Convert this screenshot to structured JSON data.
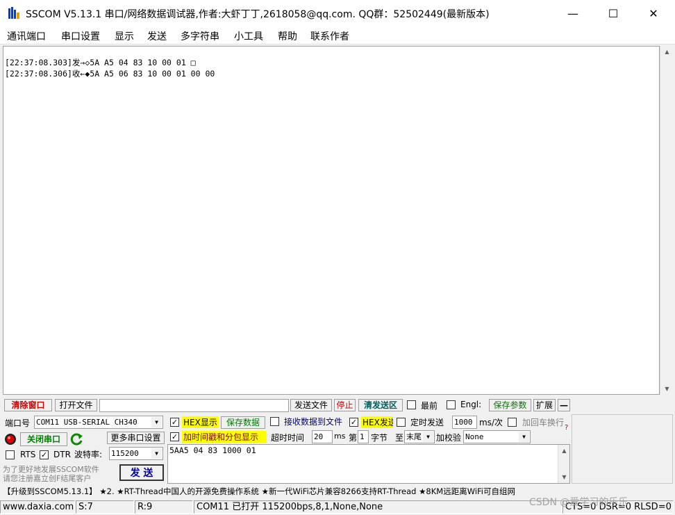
{
  "window": {
    "title": "SSCOM V5.13.1 串口/网络数据调试器,作者:大虾丁丁,2618058@qq.com. QQ群：52502449(最新版本)",
    "minimize": "—",
    "maximize": "☐",
    "close": "✕"
  },
  "menu": [
    "通讯端口",
    "串口设置",
    "显示",
    "发送",
    "多字符串",
    "小工具",
    "帮助",
    "联系作者"
  ],
  "recv_lines": [
    "[22:37:08.303]发→◇5A A5 04 83 10 00 01 □",
    "[22:37:08.306]收←◆5A A5 06 83 10 00 01 00 00"
  ],
  "toolbar": {
    "clear_window": "清除窗口",
    "open_file": "打开文件",
    "file_path": "",
    "send_file": "发送文件",
    "stop": "停止",
    "clear_send": "清发送区",
    "latest": "最前",
    "english": "Engl:",
    "save_params": "保存参数",
    "expand": "扩展",
    "collapse": "—"
  },
  "port": {
    "port_label": "端口号",
    "port_value": "COM11 USB-SERIAL CH340",
    "close_port": "关闭串口",
    "more_settings": "更多串口设置",
    "rts": "RTS",
    "dtr": "DTR",
    "baud_label": "波特率:",
    "baud_value": "115200",
    "promo_line1": "为了更好地发展SSCOM软件",
    "promo_line2": "请您注册嘉立创F结尾客户",
    "send_button": "发  送"
  },
  "options": {
    "hex_display": "HEX显示",
    "save_data": "保存数据",
    "recv_to_file": "接收数据到文件",
    "hex_send": "HEX发送",
    "timed_send": "定时发送",
    "timed_value": "1000",
    "timed_unit": "ms/次",
    "add_crlf": "加回车换行",
    "add_timestamp": "加时间戳和分包显示",
    "timeout_label": "超时时间",
    "timeout_value": "20",
    "timeout_unit": "ms",
    "byte_prefix": "第",
    "byte_value": "1",
    "byte_label": "字节",
    "to_label": "至",
    "to_value": "末尾",
    "checksum_label": "加校验",
    "checksum_value": "None",
    "check_mark": "✓"
  },
  "send_text": "5AA5 04 83 1000 01",
  "ticker": "【升级到SSCOM5.13.1】 ★2. ★RT-Thread中国人的开源免费操作系统 ★新一代WiFi芯片兼容8266支持RT-Thread ★8KM远距离WiFi可自组网",
  "status": {
    "website": "www.daxia.com",
    "sent": "S:7",
    "received": "R:9",
    "port_state": "COM11 已打开  115200bps,8,1,None,None",
    "signals": "CTS=0 DSR=0 RLSD=0"
  },
  "watermark": "CSDN @爱学习的乐乐"
}
